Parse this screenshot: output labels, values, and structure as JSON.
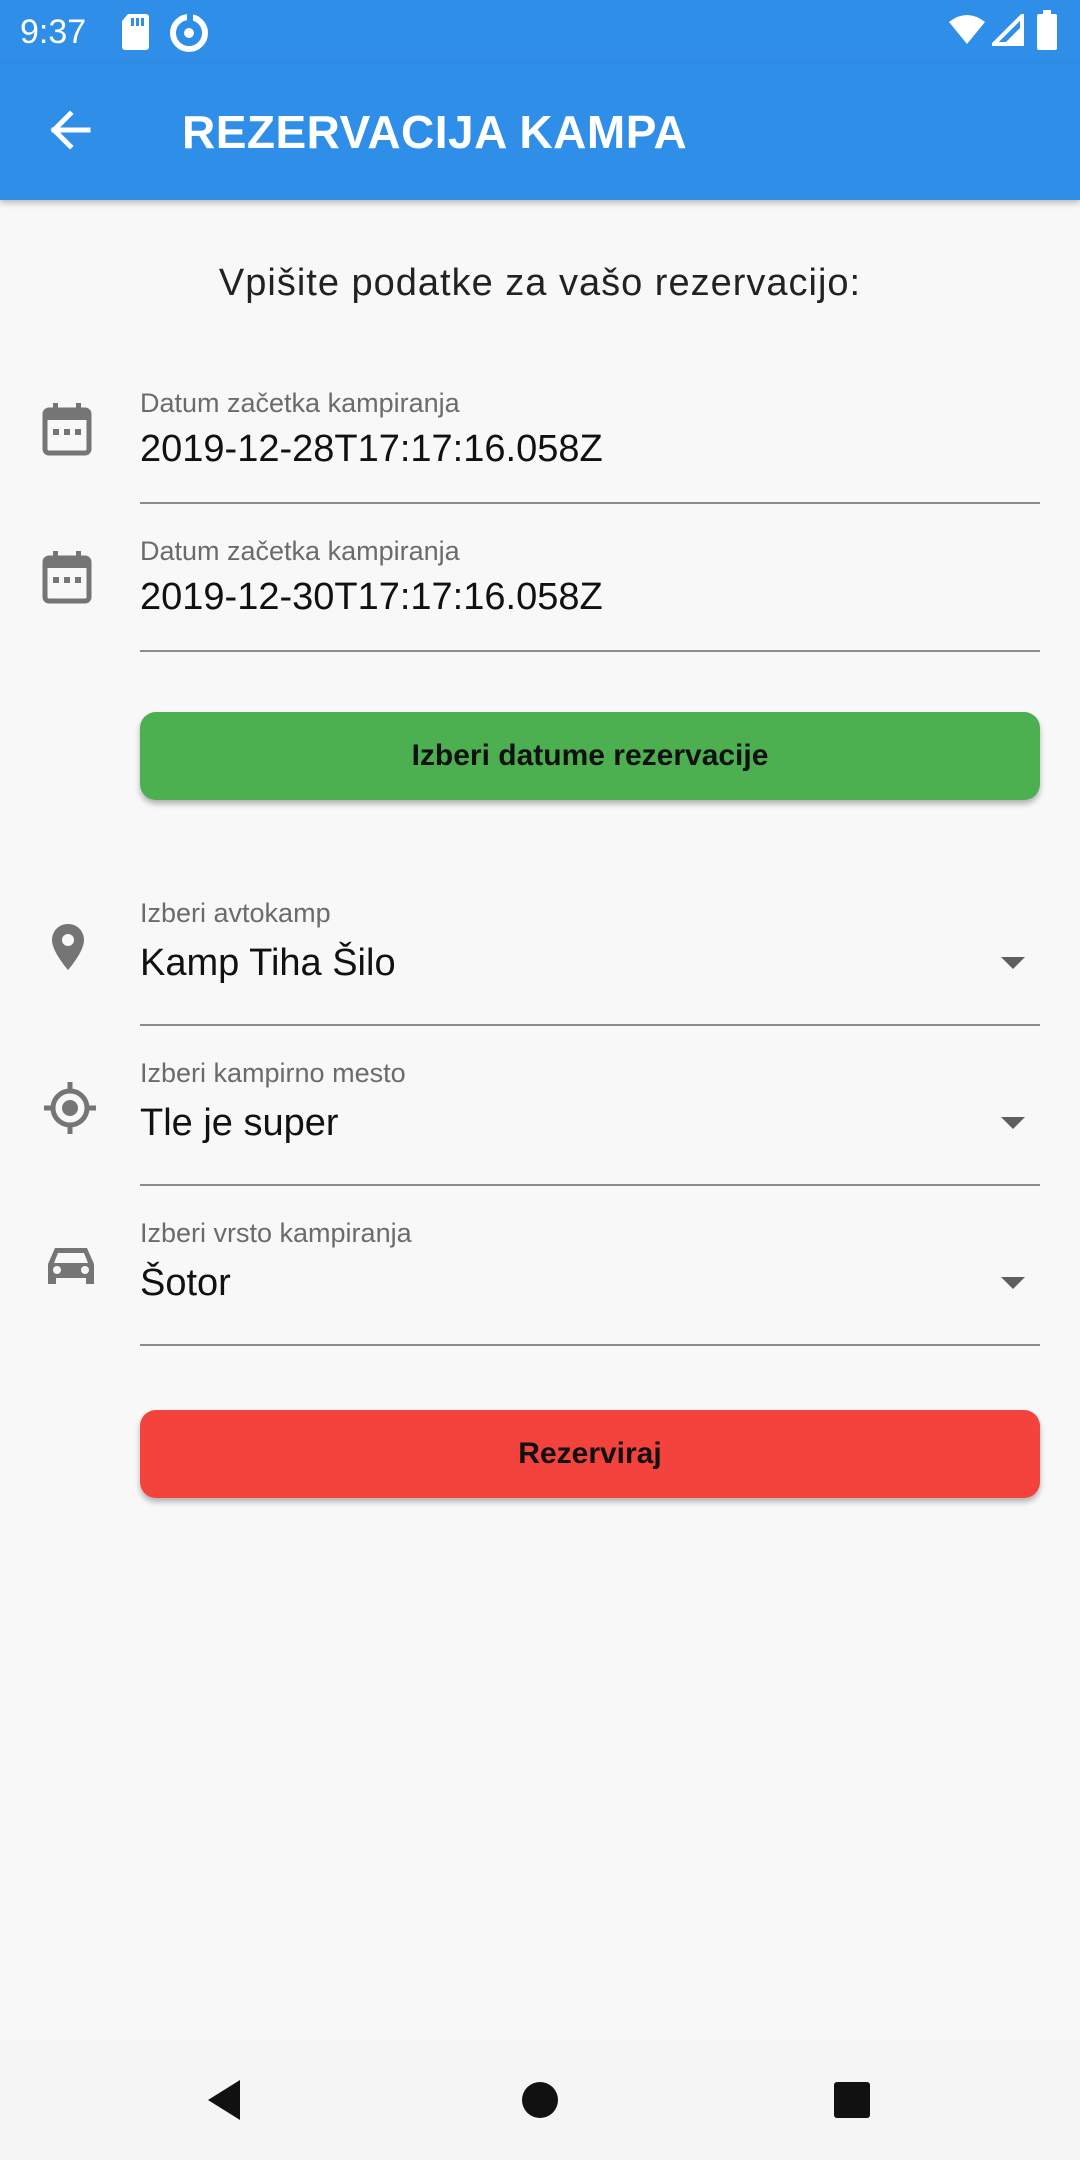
{
  "status_bar": {
    "time": "9:37",
    "left_icons": [
      "sd-card-icon",
      "data-saver-icon"
    ],
    "right_icons": [
      "wifi-icon",
      "cell-signal-icon",
      "battery-icon"
    ]
  },
  "app_bar": {
    "title": "REZERVACIJA KAMPA",
    "back_icon": "arrow-back-icon"
  },
  "form": {
    "heading": "Vpišite podatke za vašo rezervacijo:",
    "start_date": {
      "label": "Datum začetka kampiranja",
      "value": "2019-12-28T17:17:16.058Z",
      "icon": "calendar-icon"
    },
    "end_date": {
      "label": "Datum začetka kampiranja",
      "value": "2019-12-30T17:17:16.058Z",
      "icon": "calendar-icon"
    },
    "pick_dates_button": "Izberi datume rezervacije",
    "camp": {
      "label": "Izberi avtokamp",
      "value": "Kamp Tiha Šilo",
      "icon": "location-pin-icon"
    },
    "site": {
      "label": "Izberi kampirno mesto",
      "value": "Tle je super",
      "icon": "gps-target-icon"
    },
    "camping_type": {
      "label": "Izberi vrsto kampiranja",
      "value": "Šotor",
      "icon": "car-icon"
    },
    "reserve_button": "Rezerviraj"
  },
  "nav_bar": {
    "buttons": [
      "back-triangle-icon",
      "home-circle-icon",
      "recents-square-icon"
    ]
  },
  "colors": {
    "primary": "#2f8ee8",
    "green_button": "#4caf50",
    "red_button": "#f4433c",
    "background": "#f8f8f8",
    "icon_gray": "#757575"
  }
}
